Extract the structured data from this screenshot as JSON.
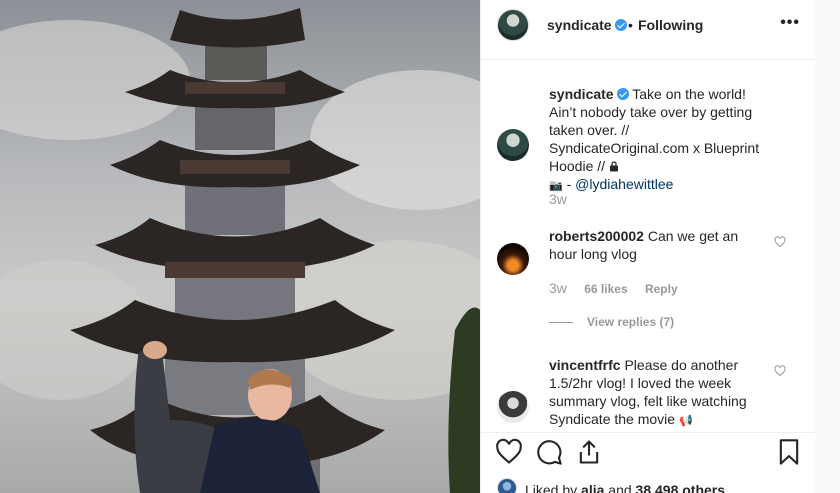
{
  "post": {
    "username": "syndicate",
    "dot": "•",
    "follow_label": "Following",
    "more_icon": "•••"
  },
  "caption": {
    "username": "syndicate",
    "text": "Take on the world! Ain’t nobody take over by getting taken over. // SyndicateOriginal.com x Blueprint Hoodie //",
    "lock_icon": "lock-icon",
    "camera_icon": "📷",
    "credit_sep": " - ",
    "credit_link": "@lydiahewittlee",
    "time": "3w"
  },
  "comments": [
    {
      "username": "roberts200002",
      "text": "Can we get an hour long vlog",
      "time": "3w",
      "likes": "66 likes",
      "reply_label": "Reply",
      "view_replies": "View replies (7)"
    },
    {
      "username": "vincentfrfc",
      "text": "Please do another 1.5/2hr vlog! I loved the week summary vlog, felt like watching Syndicate the movie",
      "emoji": "📢"
    }
  ],
  "liked_by": {
    "prefix": "Liked by ",
    "user": "alia",
    "middle": " and ",
    "others": "38,498 others"
  }
}
